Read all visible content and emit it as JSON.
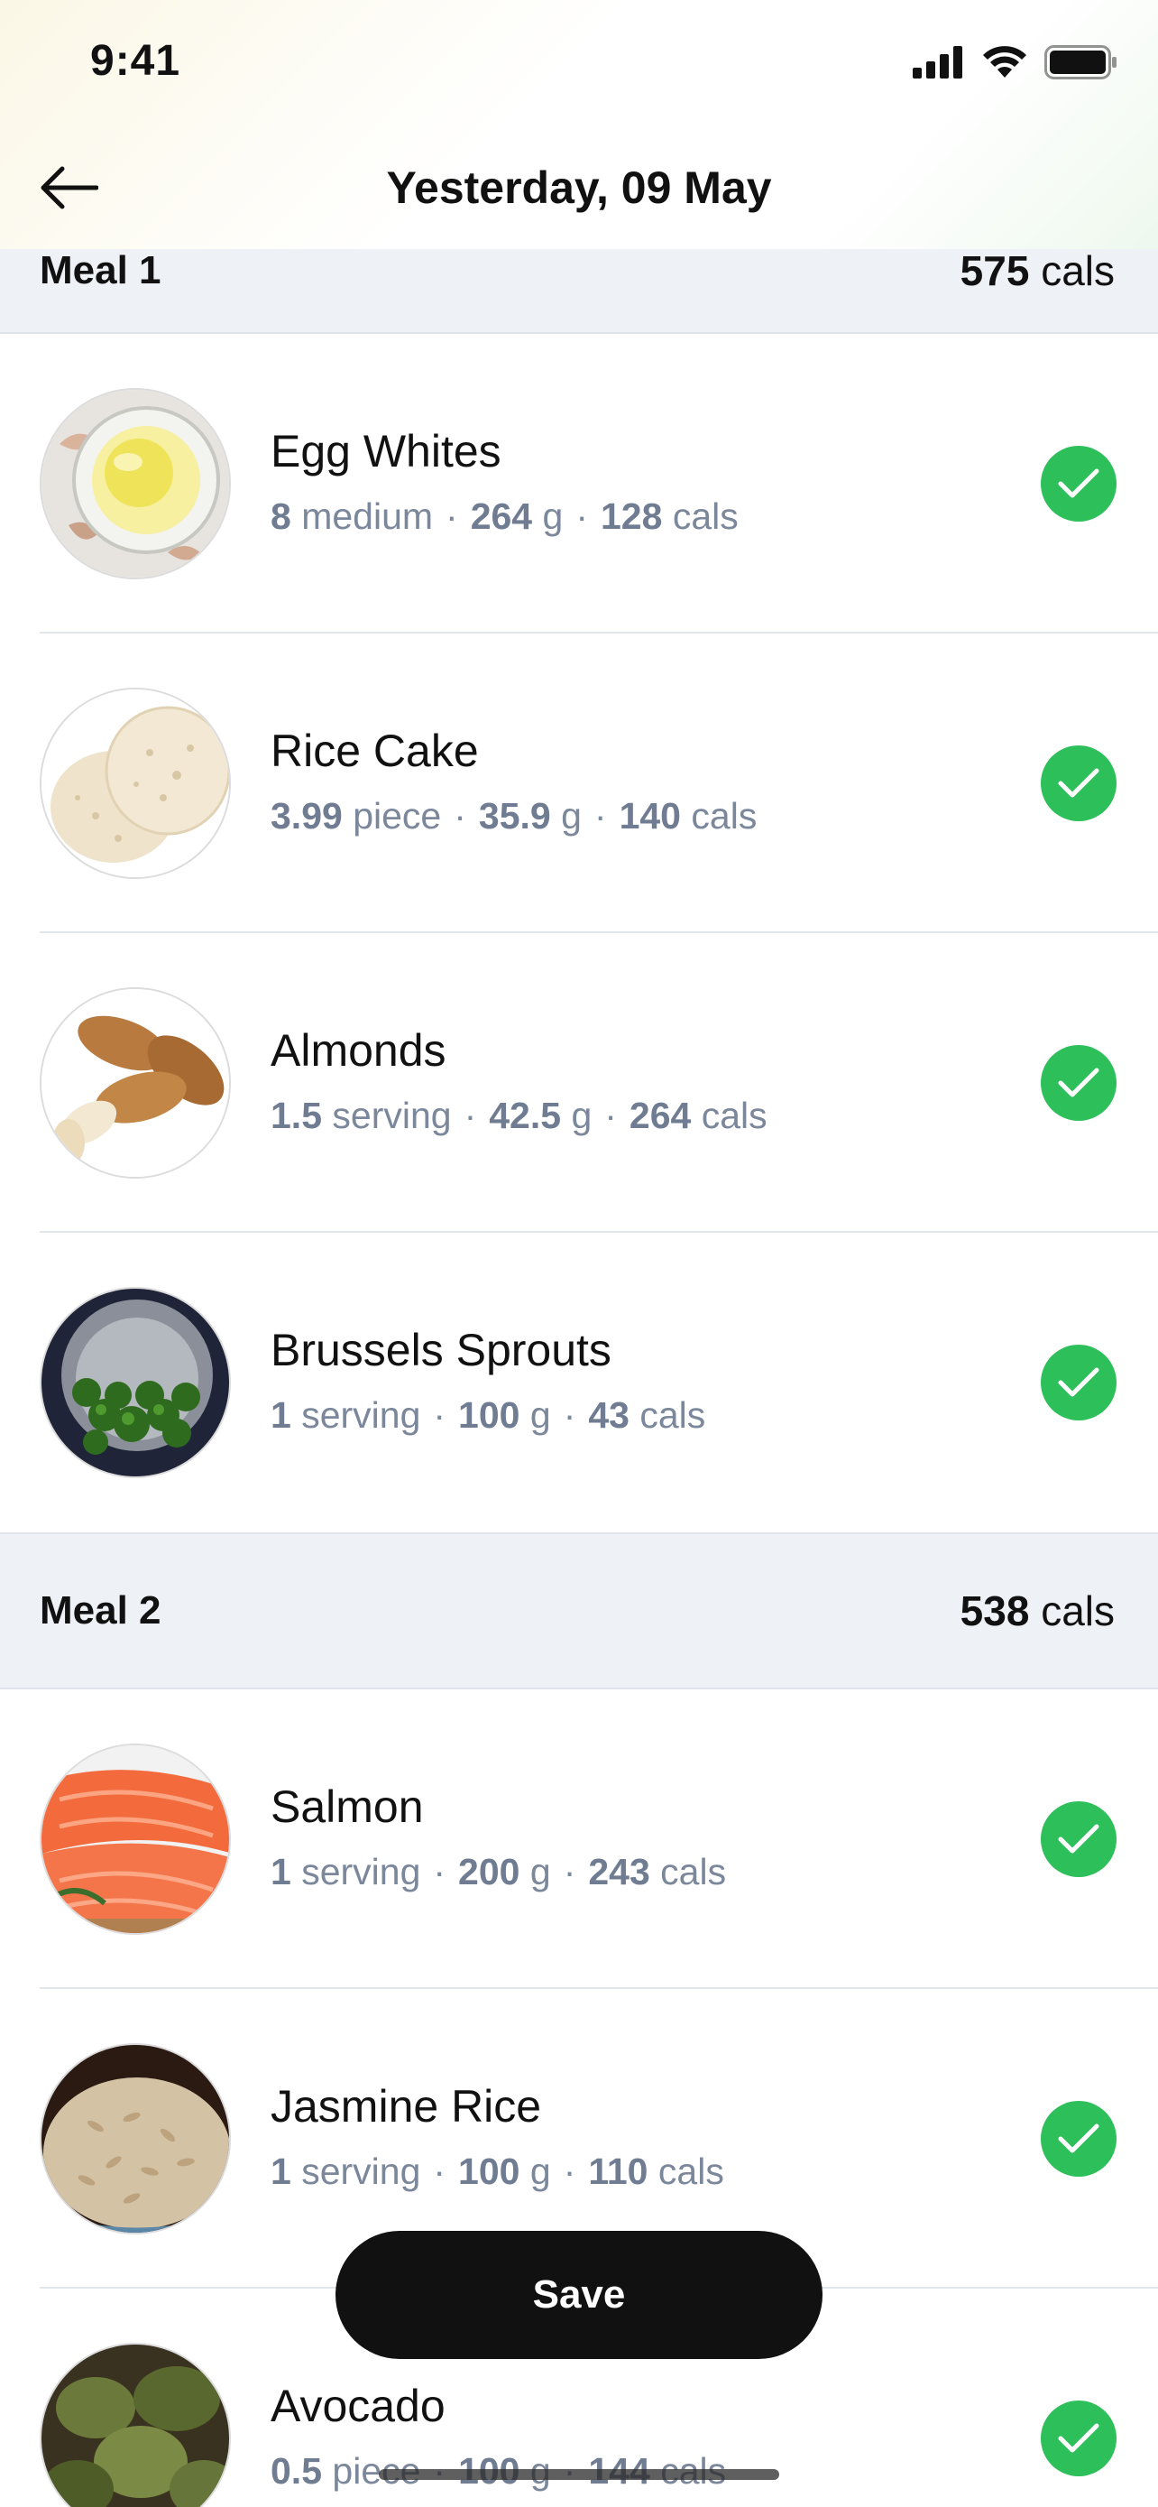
{
  "status_bar": {
    "time": "9:41"
  },
  "header": {
    "title": "Yesterday, 09 May"
  },
  "meals": [
    {
      "name": "Meal 1",
      "cals_value": "575",
      "cals_unit": "cals",
      "items": [
        {
          "name": "Egg Whites",
          "qty": "8",
          "unit": "medium",
          "weight": "264",
          "weight_unit": "g",
          "cals": "128",
          "cals_unit": "cals"
        },
        {
          "name": "Rice Cake",
          "qty": "3.99",
          "unit": "piece",
          "weight": "35.9",
          "weight_unit": "g",
          "cals": "140",
          "cals_unit": "cals"
        },
        {
          "name": "Almonds",
          "qty": "1.5",
          "unit": "serving",
          "weight": "42.5",
          "weight_unit": "g",
          "cals": "264",
          "cals_unit": "cals"
        },
        {
          "name": "Brussels Sprouts",
          "qty": "1",
          "unit": "serving",
          "weight": "100",
          "weight_unit": "g",
          "cals": "43",
          "cals_unit": "cals"
        }
      ]
    },
    {
      "name": "Meal 2",
      "cals_value": "538",
      "cals_unit": "cals",
      "items": [
        {
          "name": "Salmon",
          "qty": "1",
          "unit": "serving",
          "weight": "200",
          "weight_unit": "g",
          "cals": "243",
          "cals_unit": "cals"
        },
        {
          "name": "Jasmine Rice",
          "qty": "1",
          "unit": "serving",
          "weight": "100",
          "weight_unit": "g",
          "cals": "110",
          "cals_unit": "cals"
        },
        {
          "name": "Avocado",
          "qty": "0.5",
          "unit": "piece",
          "weight": "100",
          "weight_unit": "g",
          "cals": "144",
          "cals_unit": "cals"
        }
      ]
    }
  ],
  "meta_separator": "·",
  "save_button": {
    "label": "Save"
  },
  "colors": {
    "check": "#2dbf5a",
    "meta_text": "#7b879b",
    "section_bg": "#eef1f5"
  }
}
